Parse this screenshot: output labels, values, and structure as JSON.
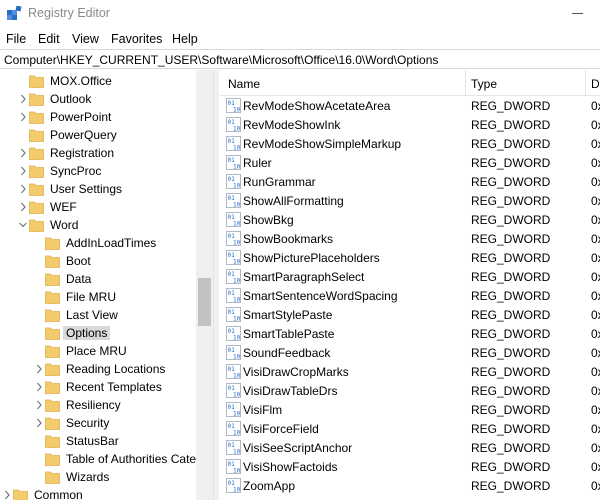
{
  "window": {
    "title": "Registry Editor",
    "icon": "registry-editor-icon"
  },
  "menu": [
    "File",
    "Edit",
    "View",
    "Favorites",
    "Help"
  ],
  "address": "Computer\\HKEY_CURRENT_USER\\Software\\Microsoft\\Office\\16.0\\Word\\Options",
  "colors": {
    "folder": "#f2cb6c",
    "folder_dark": "#e3b04b",
    "selection": "#d9d9d9",
    "reg_icon_blue": "#2b6cc4"
  },
  "tree": {
    "items": [
      {
        "label": "MOX.Office",
        "level": 1,
        "expander": "none"
      },
      {
        "label": "Outlook",
        "level": 1,
        "expander": "collapsed"
      },
      {
        "label": "PowerPoint",
        "level": 1,
        "expander": "collapsed"
      },
      {
        "label": "PowerQuery",
        "level": 1,
        "expander": "none"
      },
      {
        "label": "Registration",
        "level": 1,
        "expander": "collapsed"
      },
      {
        "label": "SyncProc",
        "level": 1,
        "expander": "collapsed"
      },
      {
        "label": "User Settings",
        "level": 1,
        "expander": "collapsed"
      },
      {
        "label": "WEF",
        "level": 1,
        "expander": "collapsed"
      },
      {
        "label": "Word",
        "level": 1,
        "expander": "expanded"
      },
      {
        "label": "AddInLoadTimes",
        "level": 2,
        "expander": "none"
      },
      {
        "label": "Boot",
        "level": 2,
        "expander": "none"
      },
      {
        "label": "Data",
        "level": 2,
        "expander": "none"
      },
      {
        "label": "File MRU",
        "level": 2,
        "expander": "none"
      },
      {
        "label": "Last View",
        "level": 2,
        "expander": "none"
      },
      {
        "label": "Options",
        "level": 2,
        "expander": "none",
        "selected": true
      },
      {
        "label": "Place MRU",
        "level": 2,
        "expander": "none"
      },
      {
        "label": "Reading Locations",
        "level": 2,
        "expander": "collapsed"
      },
      {
        "label": "Recent Templates",
        "level": 2,
        "expander": "collapsed"
      },
      {
        "label": "Resiliency",
        "level": 2,
        "expander": "collapsed"
      },
      {
        "label": "Security",
        "level": 2,
        "expander": "collapsed"
      },
      {
        "label": "StatusBar",
        "level": 2,
        "expander": "none"
      },
      {
        "label": "Table of Authorities Cate",
        "level": 2,
        "expander": "none"
      },
      {
        "label": "Wizards",
        "level": 2,
        "expander": "none"
      },
      {
        "label": "Common",
        "level": 0,
        "expander": "collapsed"
      }
    ]
  },
  "list": {
    "columns": {
      "name": "Name",
      "type": "Type",
      "data": "Da"
    },
    "rows": [
      {
        "name": "RevModeShowAcetateArea",
        "type": "REG_DWORD",
        "data": "0x"
      },
      {
        "name": "RevModeShowInk",
        "type": "REG_DWORD",
        "data": "0x"
      },
      {
        "name": "RevModeShowSimpleMarkup",
        "type": "REG_DWORD",
        "data": "0x"
      },
      {
        "name": "Ruler",
        "type": "REG_DWORD",
        "data": "0x"
      },
      {
        "name": "RunGrammar",
        "type": "REG_DWORD",
        "data": "0x"
      },
      {
        "name": "ShowAllFormatting",
        "type": "REG_DWORD",
        "data": "0x"
      },
      {
        "name": "ShowBkg",
        "type": "REG_DWORD",
        "data": "0x"
      },
      {
        "name": "ShowBookmarks",
        "type": "REG_DWORD",
        "data": "0x"
      },
      {
        "name": "ShowPicturePlaceholders",
        "type": "REG_DWORD",
        "data": "0x"
      },
      {
        "name": "SmartParagraphSelect",
        "type": "REG_DWORD",
        "data": "0x"
      },
      {
        "name": "SmartSentenceWordSpacing",
        "type": "REG_DWORD",
        "data": "0x"
      },
      {
        "name": "SmartStylePaste",
        "type": "REG_DWORD",
        "data": "0x"
      },
      {
        "name": "SmartTablePaste",
        "type": "REG_DWORD",
        "data": "0x"
      },
      {
        "name": "SoundFeedback",
        "type": "REG_DWORD",
        "data": "0x"
      },
      {
        "name": "VisiDrawCropMarks",
        "type": "REG_DWORD",
        "data": "0x"
      },
      {
        "name": "VisiDrawTableDrs",
        "type": "REG_DWORD",
        "data": "0x"
      },
      {
        "name": "VisiFlm",
        "type": "REG_DWORD",
        "data": "0x"
      },
      {
        "name": "VisiForceField",
        "type": "REG_DWORD",
        "data": "0x"
      },
      {
        "name": "VisiSeeScriptAnchor",
        "type": "REG_DWORD",
        "data": "0x"
      },
      {
        "name": "VisiShowFactoids",
        "type": "REG_DWORD",
        "data": "0x"
      },
      {
        "name": "ZoomApp",
        "type": "REG_DWORD",
        "data": "0x"
      }
    ]
  }
}
